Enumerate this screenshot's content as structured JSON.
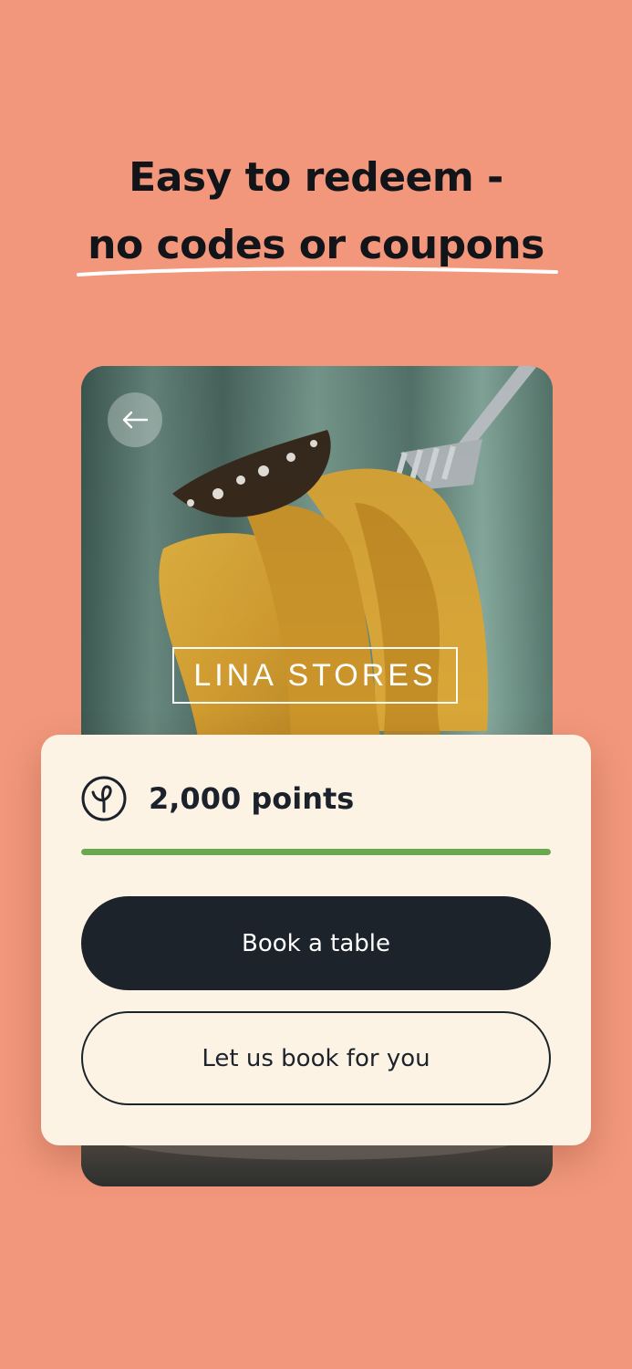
{
  "headline": {
    "line1": "Easy to redeem -",
    "line2": "no codes or coupons"
  },
  "restaurant": {
    "logo_text": "LINA  STORES",
    "back_icon": "arrow-left-icon"
  },
  "offer": {
    "points_icon": "points-logo-icon",
    "points_label": "2,000 points",
    "progress": 1.0,
    "progress_color": "#6aa84f"
  },
  "actions": {
    "primary_label": "Book a table",
    "secondary_label": "Let us book for you"
  },
  "colors": {
    "background": "#f2977b",
    "panel": "#fdf3e4",
    "dark": "#1c232b",
    "accent_green": "#6aa84f"
  }
}
